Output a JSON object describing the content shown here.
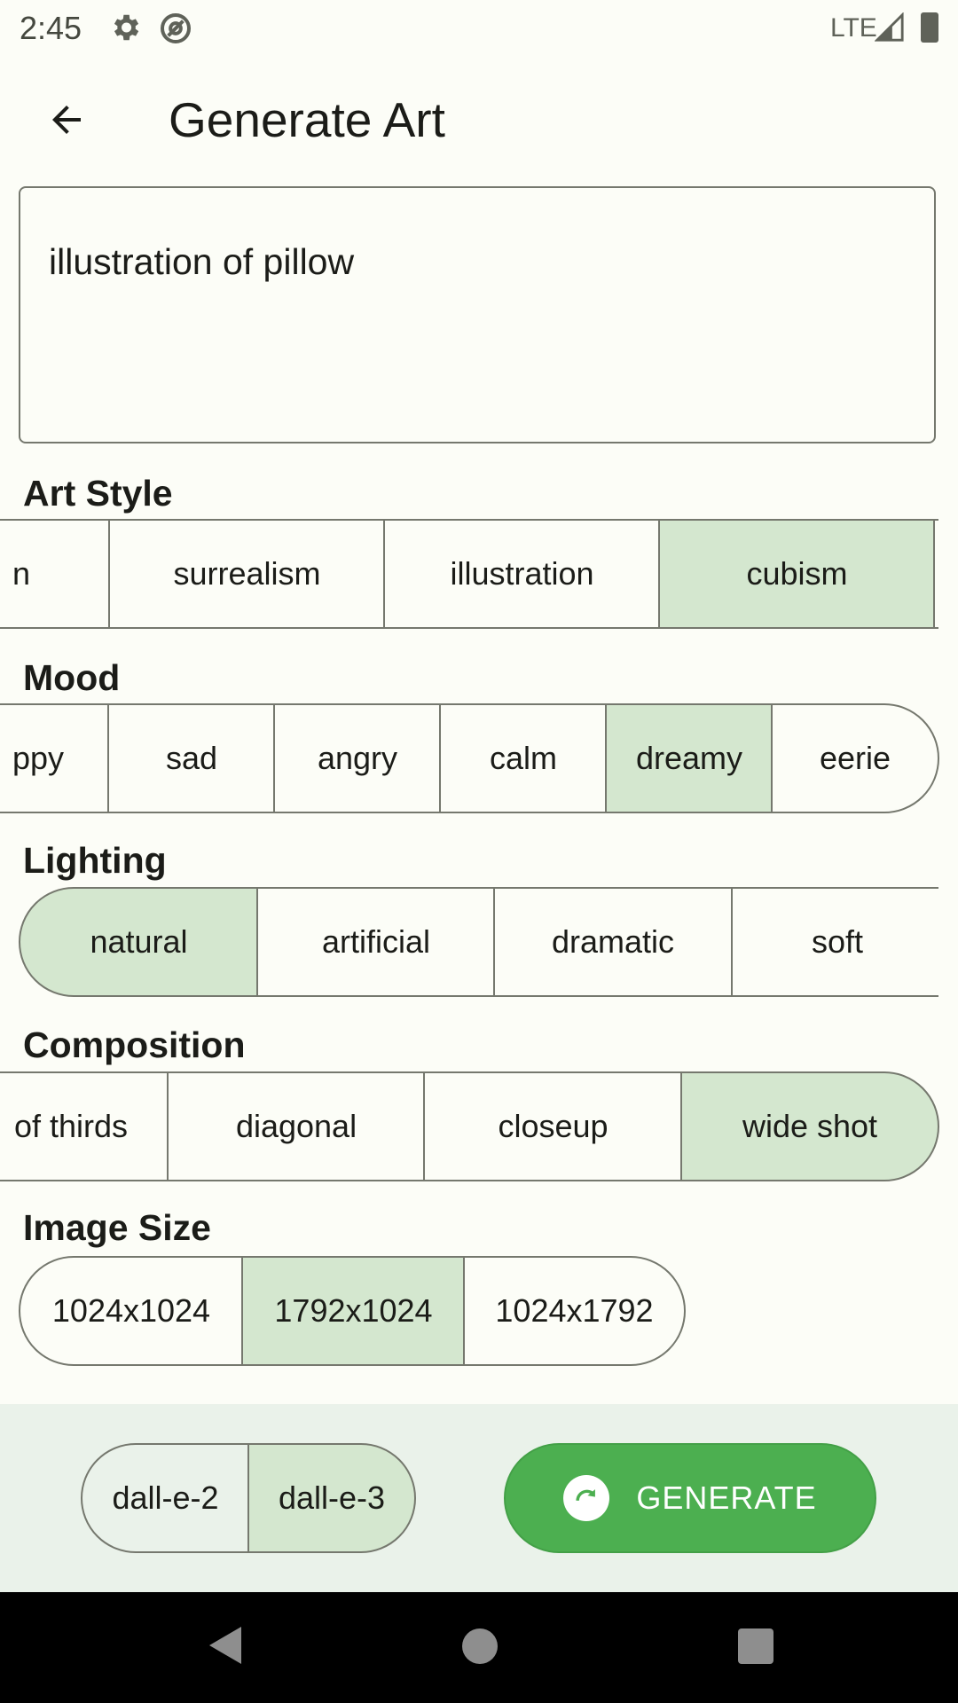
{
  "status_bar": {
    "time": "2:45",
    "network": "LTE"
  },
  "app_bar": {
    "title": "Generate Art"
  },
  "prompt": {
    "value": "illustration of pillow"
  },
  "sections": {
    "art_style": {
      "label": "Art Style",
      "options": [
        "n",
        "surrealism",
        "illustration",
        "cubism"
      ],
      "selected": "cubism"
    },
    "mood": {
      "label": "Mood",
      "options": [
        "ppy",
        "sad",
        "angry",
        "calm",
        "dreamy",
        "eerie"
      ],
      "selected": "dreamy"
    },
    "lighting": {
      "label": "Lighting",
      "options": [
        "natural",
        "artificial",
        "dramatic",
        "soft"
      ],
      "selected": "natural"
    },
    "composition": {
      "label": "Composition",
      "options": [
        "of thirds",
        "diagonal",
        "closeup",
        "wide shot"
      ],
      "selected": "wide shot"
    },
    "image_size": {
      "label": "Image Size",
      "options": [
        "1024x1024",
        "1792x1024",
        "1024x1792"
      ],
      "selected": "1792x1024"
    }
  },
  "model": {
    "options": [
      "dall-e-2",
      "dall-e-3"
    ],
    "selected": "dall-e-3"
  },
  "generate_button": {
    "label": "GENERATE"
  },
  "colors": {
    "selected_segment": "#d4e7cf",
    "accent": "#4caf50",
    "outline": "#75786e"
  }
}
